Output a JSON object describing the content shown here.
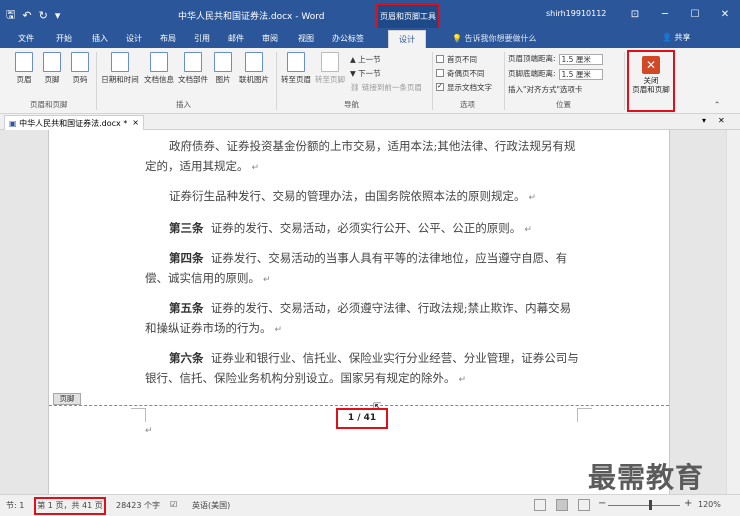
{
  "titlebar": {
    "qat": [
      "save-icon",
      "undo-icon",
      "redo-icon",
      "customize-icon"
    ],
    "title": "中华人民共和国证券法.docx - Word",
    "context_tool": "页眉和页脚工具",
    "user": "shirh19910112",
    "window_buttons": [
      "ribbon-display-icon",
      "minimize-icon",
      "restore-icon",
      "close-icon"
    ]
  },
  "tabs": [
    "文件",
    "开始",
    "插入",
    "设计",
    "布局",
    "引用",
    "邮件",
    "审阅",
    "视图",
    "办公标签"
  ],
  "active_tab": "设计",
  "tellme": "告诉我你想要做什么",
  "share": "共享",
  "ribbon": {
    "group1": {
      "label": "页眉和页脚",
      "items": [
        "页眉",
        "页脚",
        "页码"
      ]
    },
    "group2": {
      "label": "插入",
      "items": [
        "日期和时间",
        "文档信息",
        "文档部件",
        "图片",
        "联机图片"
      ]
    },
    "group3": {
      "label": "导航",
      "items": [
        "转至页眉",
        "转至页脚",
        "上一节",
        "下一节",
        "链接到前一条页眉"
      ]
    },
    "group4": {
      "label": "选项",
      "items": [
        {
          "text": "首页不同",
          "checked": false
        },
        {
          "text": "奇偶页不同",
          "checked": false
        },
        {
          "text": "显示文档文字",
          "checked": true
        }
      ]
    },
    "group5": {
      "label": "位置",
      "items": [
        "页眉顶端距离:",
        "页脚底端距离:",
        "插入\"对齐方式\"选项卡"
      ],
      "values": [
        "1.5 厘米",
        "1.5 厘米"
      ]
    },
    "group6": {
      "label": "关闭",
      "close_line1": "关闭",
      "close_line2": "页眉和页脚"
    }
  },
  "doc_tab": {
    "name": "中华人民共和国证券法.docx",
    "close": "×",
    "modified": "*"
  },
  "document": {
    "p1": "政府债券、证券投资基金份额的上市交易，适用本法;其他法律、行政法规另有规定的，适用其规定。",
    "p2": "证券衍生品种发行、交易的管理办法，由国务院依照本法的原则规定。",
    "p3_title": "第三条",
    "p3": "证券的发行、交易活动，必须实行公开、公平、公正的原则。",
    "p4_title": "第四条",
    "p4": "证券发行、交易活动的当事人具有平等的法律地位，应当遵守自愿、有偿、诚实信用的原则。",
    "p5_title": "第五条",
    "p5": "证券的发行、交易活动，必须遵守法律、行政法规;禁止欺诈、内幕交易和操纵证券市场的行为。",
    "p6_title": "第六条",
    "p6": "证券业和银行业、信托业、保险业实行分业经营、分业管理，证券公司与银行、信托、保险业务机构分别设立。国家另有规定的除外。",
    "para_mark": "↵",
    "footer_label": "页脚",
    "page_number": "1 / 41"
  },
  "watermark": "最需教育",
  "status": {
    "section": "节: 1",
    "page": "第 1 页，共 41 页",
    "words": "28423 个字",
    "language": "英语(美国)",
    "zoom": "120%",
    "zoom_minus": "−",
    "zoom_plus": "+"
  },
  "colors": {
    "accent": "#2b579a",
    "highlight": "#e0101a"
  }
}
